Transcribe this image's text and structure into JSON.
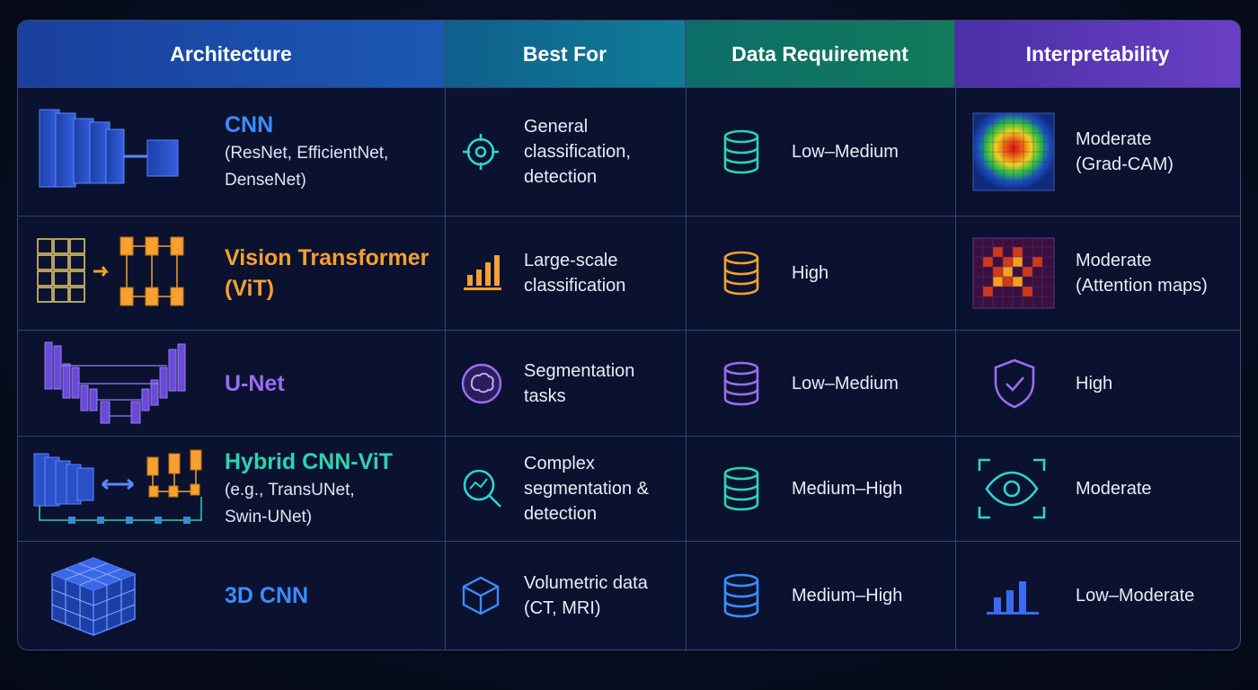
{
  "headers": {
    "architecture": "Architecture",
    "best_for": "Best For",
    "data_requirement": "Data Requirement",
    "interpretability": "Interpretability"
  },
  "rows": [
    {
      "name": "CNN",
      "sub": [
        "(ResNet, EfficientNet,",
        "DenseNet)"
      ],
      "name_color": "#3b8cff",
      "best_for": [
        "General classification,",
        "detection"
      ],
      "best_icon": "target-icon",
      "data": "Low–Medium",
      "db_color": "#2ed3b0",
      "interp": [
        "Moderate",
        "(Grad-CAM)"
      ],
      "interp_icon": "gradcam-heatmap-icon"
    },
    {
      "name": "Vision Transformer",
      "name2": "(ViT)",
      "sub": [],
      "name_color": "#f5a030",
      "best_for": [
        "Large-scale",
        "classification"
      ],
      "best_icon": "bar-chart-icon",
      "data": "High",
      "db_color": "#f5a030",
      "interp": [
        "Moderate",
        "(Attention maps)"
      ],
      "interp_icon": "attention-map-icon"
    },
    {
      "name": "U-Net",
      "sub": [],
      "name_color": "#9a6cf0",
      "best_for": [
        "Segmentation",
        "tasks"
      ],
      "best_icon": "segmentation-blob-icon",
      "data": "Low–Medium",
      "db_color": "#9a6cf0",
      "interp": [
        "High"
      ],
      "interp_icon": "shield-check-icon"
    },
    {
      "name": "Hybrid CNN-ViT",
      "sub": [
        "(e.g., TransUNet,",
        "Swin-UNet)"
      ],
      "name_color": "#2ed3b0",
      "best_for": [
        "Complex",
        "segmentation &",
        "detection"
      ],
      "best_icon": "magnifier-graph-icon",
      "data": "Medium–High",
      "db_color": "#2ed3b0",
      "interp": [
        "Moderate"
      ],
      "interp_icon": "eye-focus-icon"
    },
    {
      "name": "3D CNN",
      "sub": [],
      "name_color": "#3b8cff",
      "best_for": [
        "Volumetric data",
        "(CT, MRI)"
      ],
      "best_icon": "cube-icon",
      "data": "Medium–High",
      "db_color": "#3b8cff",
      "interp": [
        "Low–Moderate"
      ],
      "interp_icon": "bar-chart-icon"
    }
  ]
}
